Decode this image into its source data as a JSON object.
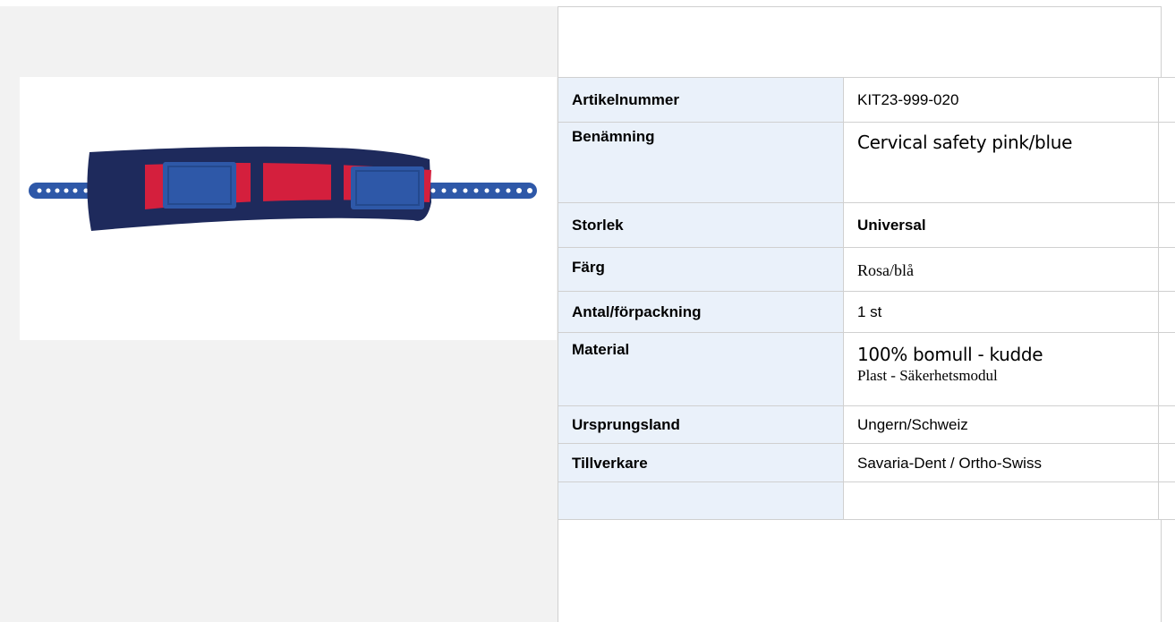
{
  "product": {
    "image_alt_icon": "cervical-safety-strap-image"
  },
  "spec_rows": [
    {
      "label": "Artikelnummer",
      "value": "KIT23-999-020"
    },
    {
      "label": "Benämning",
      "value": "Cervical safety pink/blue"
    },
    {
      "label": "Storlek",
      "value": "Universal"
    },
    {
      "label": "Färg",
      "value": "Rosa/blå"
    },
    {
      "label": "Antal/förpackning",
      "value": "1 st"
    },
    {
      "label": "Material",
      "value": "100% bomull - kudde",
      "value2": "Plast - Säkerhetsmodul"
    },
    {
      "label": "Ursprungsland",
      "value": "Ungern/Schweiz"
    },
    {
      "label": "Tillverkare",
      "value": "Savaria-Dent / Ortho-Swiss"
    }
  ],
  "colors": {
    "label_bg": "#eaf1fa",
    "left_panel_bg": "#f2f2f2",
    "strap_navy": "#1e2a5c",
    "strap_red": "#d41f3d",
    "buckle_blue": "#2e58a8"
  }
}
